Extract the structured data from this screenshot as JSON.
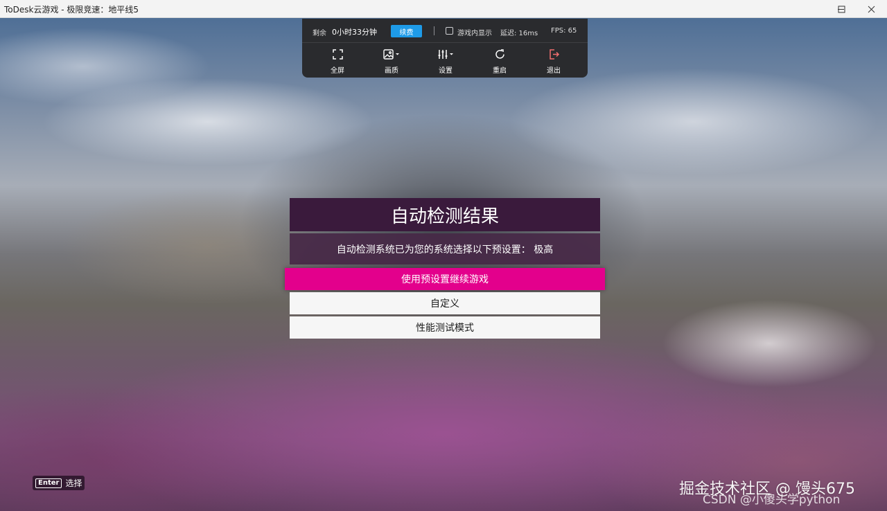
{
  "window": {
    "title": "ToDesk云游戏 - 极限竞速：地平线5"
  },
  "toolbar": {
    "remaining_label": "剩余",
    "remaining_value": "0小时33分钟",
    "renew_label": "续费",
    "in_game_display_label": "游戏内显示",
    "in_game_display_checked": false,
    "latency_label": "延迟: 16ms",
    "fps_label": "FPS:  65",
    "items": [
      {
        "label": "全屏",
        "icon": "fullscreen-icon"
      },
      {
        "label": "画质",
        "icon": "image-quality-icon"
      },
      {
        "label": "设置",
        "icon": "settings-sliders-icon"
      },
      {
        "label": "重启",
        "icon": "restart-icon"
      },
      {
        "label": "退出",
        "icon": "exit-icon"
      }
    ]
  },
  "dialog": {
    "title": "自动检测结果",
    "message": "自动检测系统已为您的系统选择以下预设置： 极高",
    "options": [
      {
        "label": "使用预设置继续游戏",
        "selected": true
      },
      {
        "label": "自定义",
        "selected": false
      },
      {
        "label": "性能测试模式",
        "selected": false
      }
    ]
  },
  "prompt": {
    "key": "Enter",
    "action": "选择"
  },
  "watermarks": {
    "line1": "掘金技术社区 @ 馒头675",
    "line2": "CSDN @小傻头学python"
  },
  "colors": {
    "accent_selected": "#e3008c",
    "renew_button": "#1e9be8",
    "exit_icon": "#f26f6f",
    "dialog_title_bg": "#3a1a3c"
  }
}
